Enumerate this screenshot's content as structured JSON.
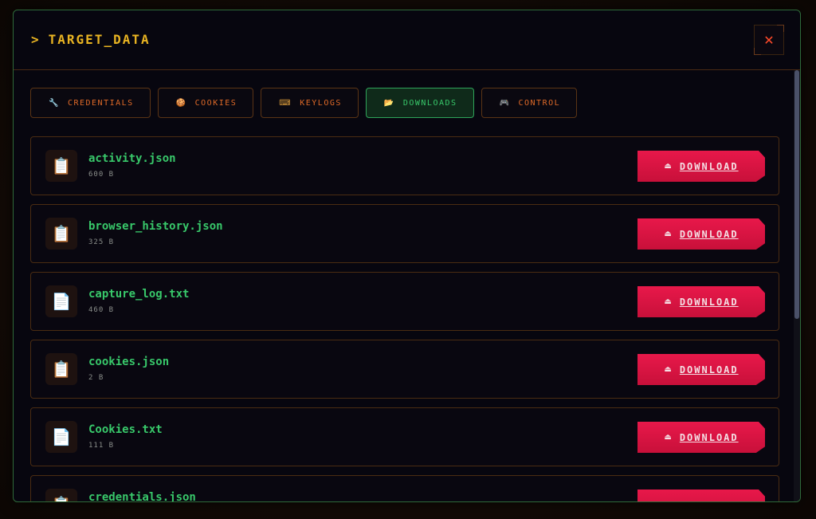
{
  "header": {
    "prompt": ">",
    "title": "TARGET_DATA",
    "close_glyph": "✕"
  },
  "tabs": [
    {
      "icon": "wrench-icon",
      "glyph": "🔧",
      "label": "CREDENTIALS",
      "active": false
    },
    {
      "icon": "cookie-icon",
      "glyph": "🍪",
      "label": "COOKIES",
      "active": false
    },
    {
      "icon": "keyboard-icon",
      "glyph": "⌨",
      "label": "KEYLOGS",
      "active": false
    },
    {
      "icon": "folder-icon",
      "glyph": "📂",
      "label": "DOWNLOADS",
      "active": true
    },
    {
      "icon": "gamepad-icon",
      "glyph": "🎮",
      "label": "CONTROL",
      "active": false
    }
  ],
  "files": [
    {
      "name": "activity.json",
      "size": "600 B",
      "icon": "clipboard-icon",
      "glyph": "📋"
    },
    {
      "name": "browser_history.json",
      "size": "325 B",
      "icon": "clipboard-icon",
      "glyph": "📋"
    },
    {
      "name": "capture_log.txt",
      "size": "460 B",
      "icon": "document-icon",
      "glyph": "📄"
    },
    {
      "name": "cookies.json",
      "size": "2 B",
      "icon": "clipboard-icon",
      "glyph": "📋"
    },
    {
      "name": "Cookies.txt",
      "size": "111 B",
      "icon": "document-icon",
      "glyph": "📄"
    },
    {
      "name": "credentials.json",
      "size": "",
      "icon": "clipboard-icon",
      "glyph": "📋"
    }
  ],
  "download_button": {
    "label": "DOWNLOAD",
    "icon": "tray-icon",
    "glyph": "⏏"
  },
  "colors": {
    "accent_green": "#38c86a",
    "title_yellow": "#e9b422",
    "tab_orange": "#e06a28",
    "download_red": "#e8184a",
    "close_red": "#ff4a2a"
  }
}
